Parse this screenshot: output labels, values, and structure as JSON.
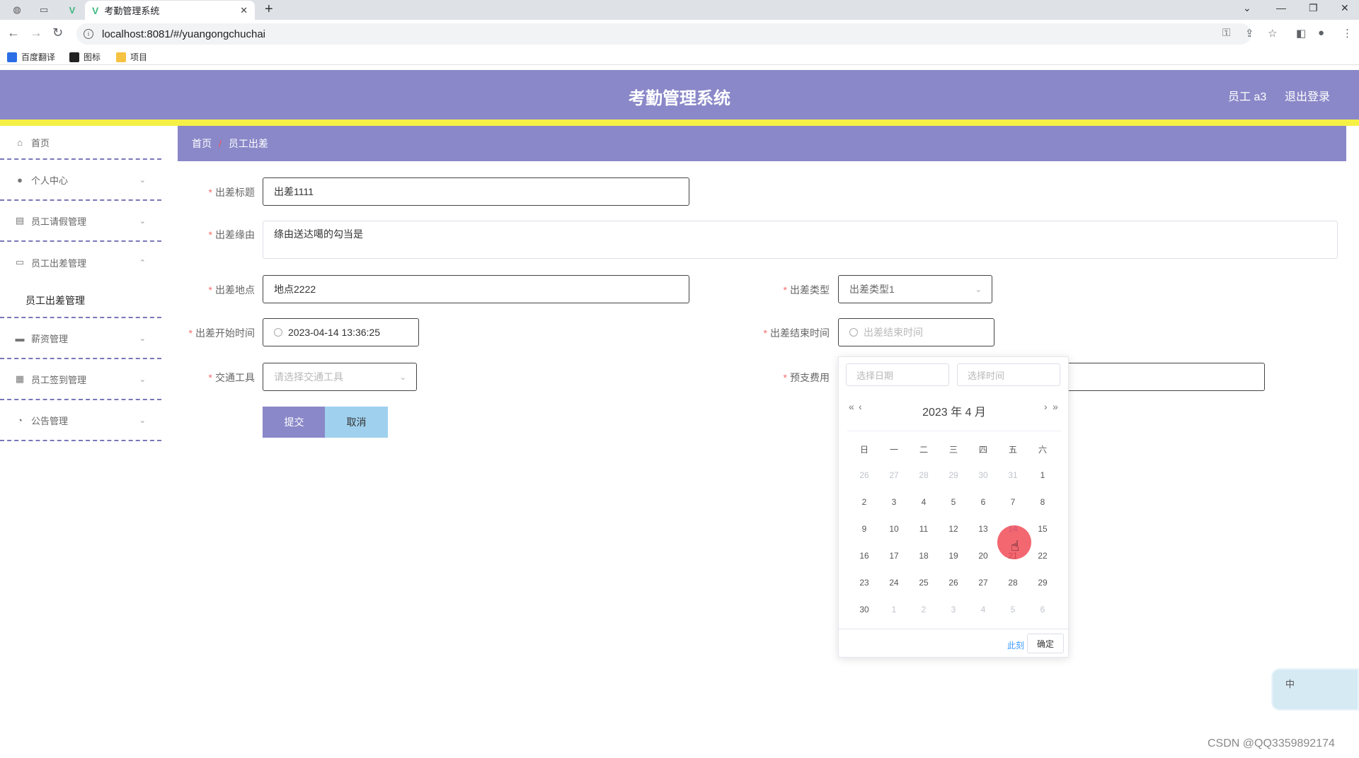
{
  "browser": {
    "tab_title": "考勤管理系统",
    "url": "localhost:8081/#/yuangongchuchai",
    "bookmarks": [
      {
        "label": "百度翻译",
        "color": "#2b6de5"
      },
      {
        "label": "图标",
        "color": "#222222"
      },
      {
        "label": "项目",
        "color": "#f5c242"
      }
    ]
  },
  "header": {
    "title": "考勤管理系统",
    "user": "员工 a3",
    "logout": "退出登录",
    "bg_color": "#8a88c8",
    "accent_bar_color": "#f5f046"
  },
  "sidebar": {
    "items": [
      {
        "label": "首页",
        "icon": "home-icon"
      },
      {
        "label": "个人中心",
        "icon": "user-icon"
      },
      {
        "label": "员工请假管理",
        "icon": "chart-icon"
      },
      {
        "label": "员工出差管理",
        "icon": "chat-icon"
      },
      {
        "label": "薪资管理",
        "icon": "monitor-icon"
      },
      {
        "label": "员工签到管理",
        "icon": "grid-icon"
      },
      {
        "label": "公告管理",
        "icon": "dial-icon"
      }
    ],
    "sub_item": "员工出差管理"
  },
  "breadcrumb": {
    "home": "首页",
    "separator": "/",
    "current": "员工出差"
  },
  "form": {
    "title_label": "出差标题",
    "title_value": "出差1111",
    "reason_label": "出差缘由",
    "reason_value": "绦由送达噶的勾当是",
    "location_label": "出差地点",
    "location_value": "地点2222",
    "type_label": "出差类型",
    "type_value": "出差类型1",
    "start_label": "出差开始时间",
    "start_value": "2023-04-14 13:36:25",
    "end_label": "出差结束时间",
    "end_placeholder": "出差结束时间",
    "transport_label": "交通工具",
    "transport_placeholder": "请选择交通工具",
    "budget_label": "预支费用",
    "submit": "提交",
    "cancel": "取消"
  },
  "datepicker": {
    "date_placeholder": "选择日期",
    "time_placeholder": "选择时间",
    "header": "2023 年  4 月",
    "weekdays": [
      "日",
      "一",
      "二",
      "三",
      "四",
      "五",
      "六"
    ],
    "weeks": [
      [
        "26",
        "27",
        "28",
        "29",
        "30",
        "31",
        "1"
      ],
      [
        "2",
        "3",
        "4",
        "5",
        "6",
        "7",
        "8"
      ],
      [
        "9",
        "10",
        "11",
        "12",
        "13",
        "14",
        "15"
      ],
      [
        "16",
        "17",
        "18",
        "19",
        "20",
        "21",
        "22"
      ],
      [
        "23",
        "24",
        "25",
        "26",
        "27",
        "28",
        "29"
      ],
      [
        "30",
        "1",
        "2",
        "3",
        "4",
        "5",
        "6"
      ]
    ],
    "today": "14",
    "now_button": "此刻",
    "ok_button": "确定"
  },
  "widget_label": "中",
  "watermark": "CSDN @QQ3359892174"
}
